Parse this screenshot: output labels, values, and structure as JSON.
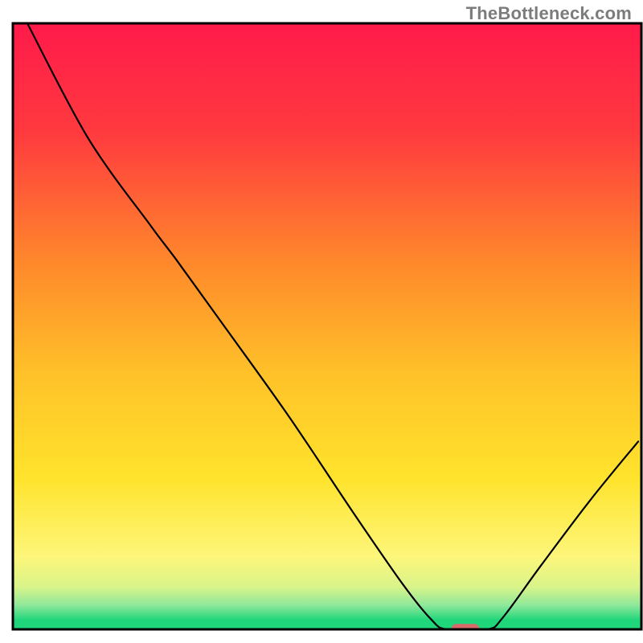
{
  "watermark": "TheBottleneck.com",
  "chart_data": {
    "type": "line",
    "title": "",
    "xlabel": "",
    "ylabel": "",
    "xlim": [
      0,
      100
    ],
    "ylim": [
      0,
      100
    ],
    "gradient_stops": [
      {
        "offset": 0.0,
        "color": "#ff1a4a"
      },
      {
        "offset": 0.18,
        "color": "#ff3a3f"
      },
      {
        "offset": 0.4,
        "color": "#ff8a2b"
      },
      {
        "offset": 0.58,
        "color": "#ffc229"
      },
      {
        "offset": 0.75,
        "color": "#ffe32c"
      },
      {
        "offset": 0.88,
        "color": "#fdf67a"
      },
      {
        "offset": 0.93,
        "color": "#d9f48a"
      },
      {
        "offset": 0.96,
        "color": "#8fe89a"
      },
      {
        "offset": 0.985,
        "color": "#1fd67a"
      },
      {
        "offset": 1.0,
        "color": "#1fd67a"
      }
    ],
    "curve": [
      {
        "x": 2.3,
        "y": 100.0
      },
      {
        "x": 12.0,
        "y": 81.0
      },
      {
        "x": 22.0,
        "y": 66.5
      },
      {
        "x": 26.0,
        "y": 61.0
      },
      {
        "x": 34.0,
        "y": 49.5
      },
      {
        "x": 44.0,
        "y": 35.0
      },
      {
        "x": 54.0,
        "y": 19.5
      },
      {
        "x": 62.0,
        "y": 7.5
      },
      {
        "x": 66.5,
        "y": 1.7
      },
      {
        "x": 69.0,
        "y": 0.0
      },
      {
        "x": 75.5,
        "y": 0.0
      },
      {
        "x": 78.0,
        "y": 2.0
      },
      {
        "x": 84.0,
        "y": 10.5
      },
      {
        "x": 92.0,
        "y": 21.5
      },
      {
        "x": 99.5,
        "y": 31.0
      }
    ],
    "marker": {
      "x": 72.0,
      "y": 0.0,
      "width": 4.5,
      "height": 1.8,
      "rx": 0.9,
      "color": "#d96a6a"
    },
    "frame_color": "#000000",
    "frame_stroke_width": 3,
    "curve_color": "#000000",
    "curve_stroke_width": 2.2
  }
}
